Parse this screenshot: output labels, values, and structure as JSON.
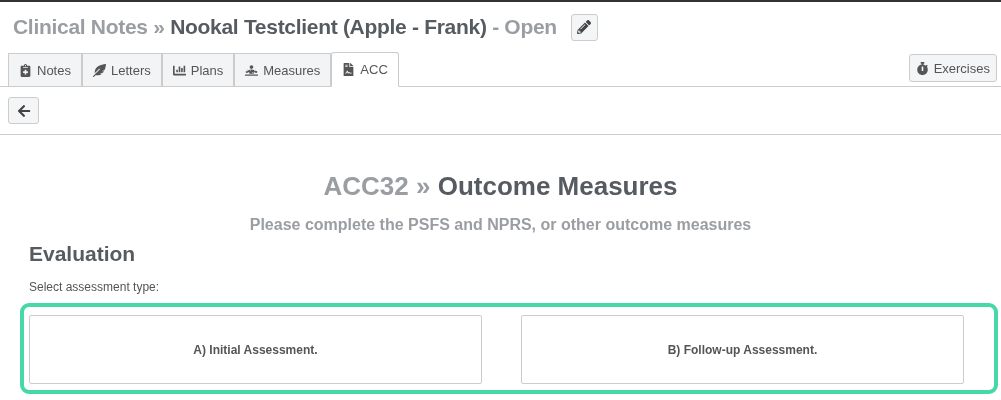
{
  "header": {
    "section": "Clinical Notes",
    "separator": "»",
    "client": "Nookal Testclient (Apple - Frank)",
    "status": "- Open"
  },
  "tabs": [
    {
      "label": "Notes",
      "selected": false
    },
    {
      "label": "Letters",
      "selected": false
    },
    {
      "label": "Plans",
      "selected": false
    },
    {
      "label": "Measures",
      "selected": false
    },
    {
      "label": "ACC",
      "selected": true
    }
  ],
  "exercises_button": "Exercises",
  "page": {
    "code": "ACC32",
    "separator": "»",
    "title": "Outcome Measures",
    "subtitle": "Please complete the PSFS and NPRS, or other outcome measures"
  },
  "evaluation": {
    "heading": "Evaluation",
    "prompt": "Select assessment type:",
    "options": [
      {
        "label": "A) Initial Assessment.",
        "selected": false
      },
      {
        "label": "B) Follow-up Assessment.",
        "selected": false
      }
    ]
  }
}
